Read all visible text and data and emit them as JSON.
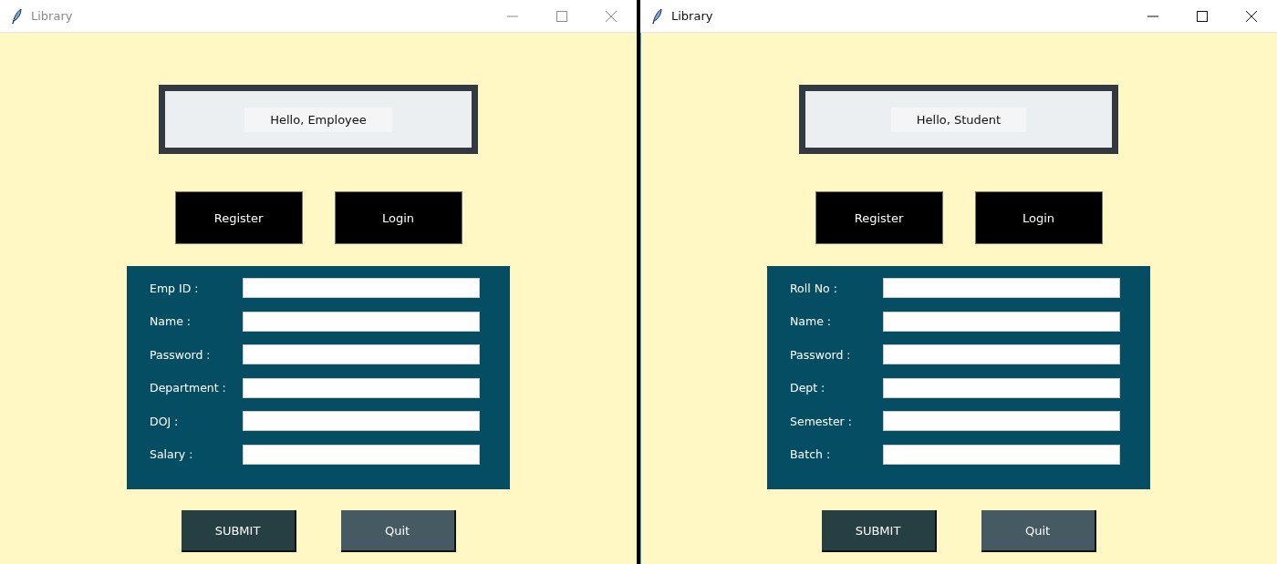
{
  "windows": [
    {
      "title": "Library",
      "active": false,
      "greeting": "Hello, Employee",
      "buttons": [
        "Register",
        "Login"
      ],
      "fields": [
        {
          "label": "Emp ID :"
        },
        {
          "label": "Name :"
        },
        {
          "label": "Password :"
        },
        {
          "label": "Department :"
        },
        {
          "label": "DOJ :"
        },
        {
          "label": "Salary :"
        }
      ],
      "submit": "SUBMIT",
      "quit": "Quit"
    },
    {
      "title": "Library",
      "active": true,
      "greeting": "Hello, Student",
      "buttons": [
        "Register",
        "Login"
      ],
      "fields": [
        {
          "label": "Roll No :"
        },
        {
          "label": "Name :"
        },
        {
          "label": "Password :"
        },
        {
          "label": "Dept :"
        },
        {
          "label": "Semester :"
        },
        {
          "label": "Batch :"
        }
      ],
      "submit": "SUBMIT",
      "quit": "Quit"
    }
  ]
}
